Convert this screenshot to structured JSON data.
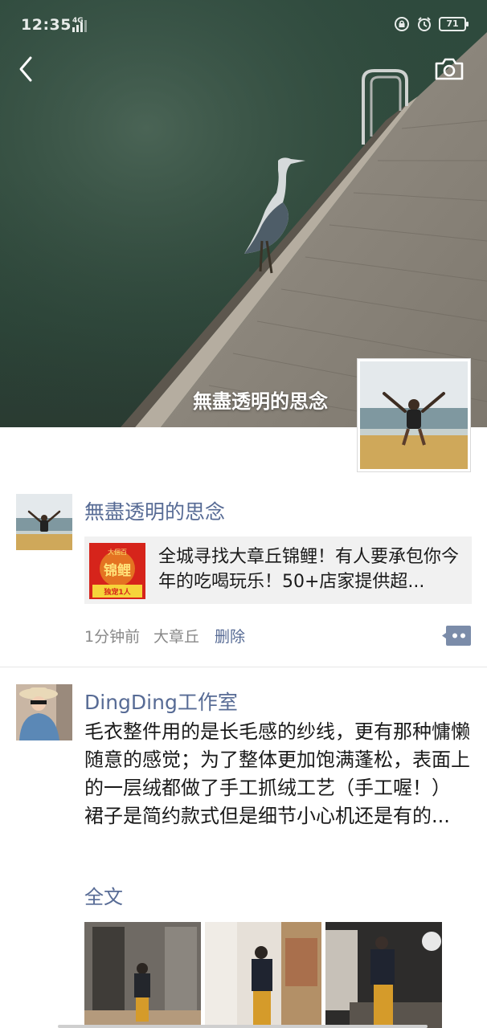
{
  "status_bar": {
    "time": "12:35",
    "network": "4G",
    "battery": "71"
  },
  "cover": {
    "user_name": "無盡透明的思念"
  },
  "posts": [
    {
      "author": "無盡透明的思念",
      "share_card": {
        "thumb_badge_top": "大個百",
        "thumb_title": "锦鲤",
        "thumb_footer": "独宠1人",
        "text": "全城寻找大章丘锦鲤！有人要承包你今年的吃喝玩乐！50+店家提供超..."
      },
      "time": "1分钟前",
      "location": "大章丘",
      "delete_label": "删除"
    },
    {
      "author": "DingDing工作室",
      "text": "毛衣整件用的是长毛感的纱线，更有那种慵懒随意的感觉；为了整体更加饱满蓬松，表面上的一层绒都做了手工抓绒工艺（手工喔！）\n裙子是简约款式但是细节小心机还是有的...",
      "full_text_label": "全文"
    }
  ],
  "colors": {
    "link": "#576b95",
    "meta": "#888888",
    "card_bg": "#f1f1f1"
  }
}
